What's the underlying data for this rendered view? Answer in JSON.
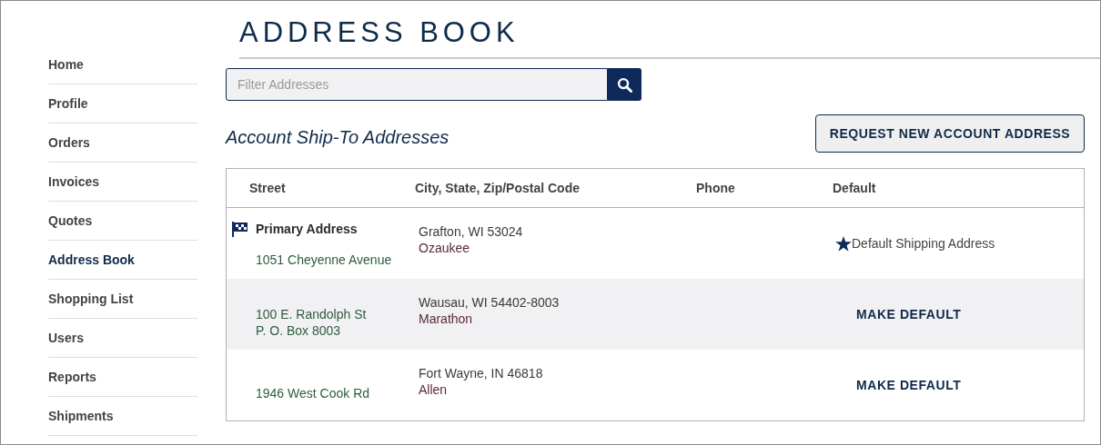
{
  "sidebar": {
    "items": [
      {
        "label": "Home",
        "selected": false
      },
      {
        "label": "Profile",
        "selected": false
      },
      {
        "label": "Orders",
        "selected": false
      },
      {
        "label": "Invoices",
        "selected": false
      },
      {
        "label": "Quotes",
        "selected": false
      },
      {
        "label": "Address Book",
        "selected": true
      },
      {
        "label": "Shopping List",
        "selected": false
      },
      {
        "label": "Users",
        "selected": false
      },
      {
        "label": "Reports",
        "selected": false
      },
      {
        "label": "Shipments",
        "selected": false
      }
    ]
  },
  "page_title": "ADDRESS BOOK",
  "search": {
    "placeholder": "Filter Addresses"
  },
  "section_title": "Account Ship-To Addresses",
  "request_button": "REQUEST NEW ACCOUNT ADDRESS",
  "table": {
    "columns": [
      "Street",
      "City, State, Zip/Postal Code",
      "Phone",
      "Default"
    ],
    "rows": [
      {
        "primary_label": "Primary Address",
        "street": [
          "1051 Cheyenne Avenue"
        ],
        "city": [
          "Grafton, WI 53024",
          "Ozaukee"
        ],
        "default": true,
        "default_text": "Default Shipping Address"
      },
      {
        "street": [
          "100 E. Randolph St",
          "P. O. Box 8003"
        ],
        "city": [
          "Wausau, WI 54402-8003",
          "Marathon"
        ],
        "default": false,
        "default_text": "MAKE DEFAULT"
      },
      {
        "street": [
          "1946 West Cook Rd"
        ],
        "city": [
          "Fort Wayne, IN 46818",
          "Allen"
        ],
        "default": false,
        "default_text": "MAKE DEFAULT"
      }
    ]
  }
}
